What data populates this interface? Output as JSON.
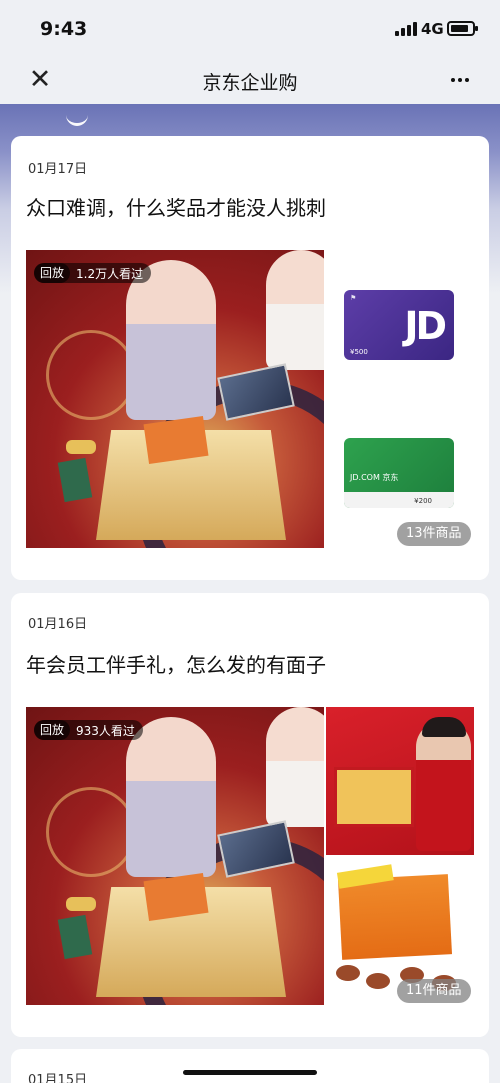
{
  "status_bar": {
    "time": "9:43",
    "network": "4G"
  },
  "nav": {
    "title": "京东企业购",
    "close_icon": "close-icon",
    "more_icon": "more-dots-icon"
  },
  "feed": [
    {
      "date": "01月17日",
      "title": "众口难调，什么奖品才能没人挑刺",
      "live_tag": "回放",
      "views": "1.2万人看过",
      "card_values": [
        "¥500",
        "¥200"
      ],
      "card_brand": "JD.COM 京东",
      "product_count": "13件商品"
    },
    {
      "date": "01月16日",
      "title": "年会员工伴手礼，怎么发的有面子",
      "live_tag": "回放",
      "views": "933人看过",
      "product_count": "11件商品"
    },
    {
      "date": "01月15日"
    }
  ],
  "colors": {
    "background": "#eef0f4",
    "card": "#ffffff",
    "banner": "#6a73b6"
  }
}
